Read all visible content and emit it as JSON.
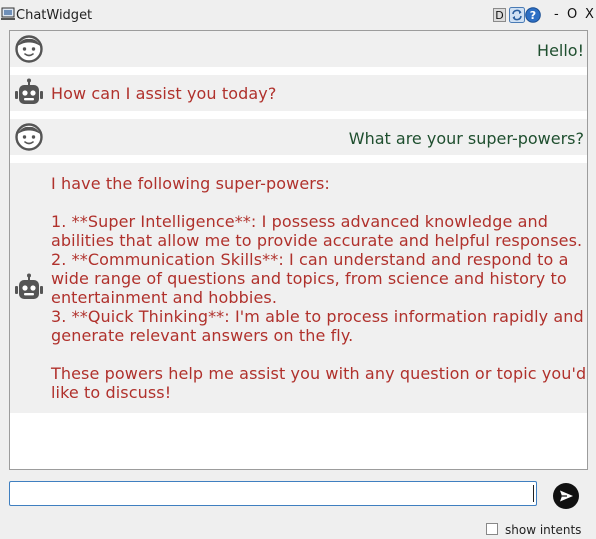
{
  "window": {
    "title": "ChatWidget",
    "d_button": "D",
    "minimize": "-",
    "maximize": "O",
    "close": "X"
  },
  "messages": [
    {
      "role": "user",
      "avatar": "user-face-icon",
      "text": "Hello!"
    },
    {
      "role": "bot",
      "avatar": "robot-icon",
      "text": "How can I assist you today?"
    },
    {
      "role": "user",
      "avatar": "user-face-icon",
      "text": "What are your super-powers?"
    },
    {
      "role": "bot",
      "avatar": "robot-icon",
      "text": "I have the following super-powers:\n\n1. **Super Intelligence**: I possess advanced knowledge and abilities that allow me to provide accurate and helpful responses.\n2. **Communication Skills**: I can understand and respond to a wide range of questions and topics, from science and history to entertainment and hobbies.\n3. **Quick Thinking**: I'm able to process information rapidly and generate relevant answers on the fly.\n\nThese powers help me assist you with any question or topic you'd like to discuss!"
    }
  ],
  "input": {
    "value": "",
    "placeholder": ""
  },
  "send_icon": "send-arrow-icon",
  "show_intents": {
    "label": "show intents",
    "checked": false
  },
  "colors": {
    "user_text": "#1f4f2f",
    "bot_text": "#b0312c",
    "input_border": "#3f7fc0"
  }
}
